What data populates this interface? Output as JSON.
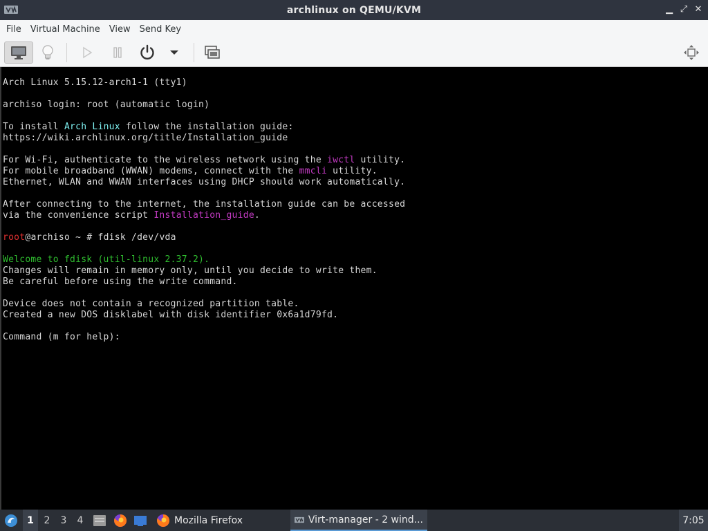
{
  "window": {
    "title": "archlinux on QEMU/KVM",
    "icon": "virt-manager-icon",
    "controls": [
      {
        "name": "minimize-button",
        "glyph": "▁"
      },
      {
        "name": "maximize-button",
        "glyph": "⤢"
      },
      {
        "name": "close-button",
        "glyph": "✕"
      }
    ]
  },
  "menu": {
    "file": "File",
    "vm": "Virtual Machine",
    "view": "View",
    "send_key": "Send Key"
  },
  "toolbar": {
    "icons": [
      "console-icon",
      "details-lightbulb-icon",
      "run-icon",
      "pause-icon",
      "power-icon",
      "power-menu-icon",
      "snapshots-icon",
      "fullscreen-icon"
    ]
  },
  "terminal": {
    "lines": [
      {
        "segments": [
          {
            "text": "Arch Linux 5.15.12-arch1-1 (tty1)",
            "color": ""
          }
        ]
      },
      {
        "segments": [
          {
            "text": "archiso login: root (automatic login)",
            "color": ""
          }
        ]
      },
      {
        "segments": [
          {
            "text": "To install ",
            "color": ""
          },
          {
            "text": "Arch Linux",
            "color": "cyan"
          },
          {
            "text": " follow the installation guide:",
            "color": ""
          }
        ]
      },
      {
        "segments": [
          {
            "text": "https://wiki.archlinux.org/title/Installation_guide",
            "color": ""
          }
        ]
      },
      {
        "segments": [
          {
            "text": "For Wi-Fi, authenticate to the wireless network using the ",
            "color": ""
          },
          {
            "text": "iwctl",
            "color": "magenta"
          },
          {
            "text": " utility.",
            "color": ""
          }
        ]
      },
      {
        "segments": [
          {
            "text": "For mobile broadband (WWAN) modems, connect with the ",
            "color": ""
          },
          {
            "text": "mmcli",
            "color": "magenta"
          },
          {
            "text": " utility.",
            "color": ""
          }
        ]
      },
      {
        "segments": [
          {
            "text": "Ethernet, WLAN and WWAN interfaces using DHCP should work automatically.",
            "color": ""
          }
        ]
      },
      {
        "segments": [
          {
            "text": "After connecting to the internet, the installation guide can be accessed",
            "color": ""
          }
        ]
      },
      {
        "segments": [
          {
            "text": "via the convenience script ",
            "color": ""
          },
          {
            "text": "Installation_guide",
            "color": "magenta"
          },
          {
            "text": ".",
            "color": ""
          }
        ]
      },
      {
        "segments": [
          {
            "text": "root",
            "color": "red"
          },
          {
            "text": "@archiso ~ # fdisk /dev/vda",
            "color": ""
          }
        ]
      },
      {
        "segments": [
          {
            "text": "Welcome to fdisk (util-linux 2.37.2).",
            "color": "green"
          }
        ]
      },
      {
        "segments": [
          {
            "text": "Changes will remain in memory only, until you decide to write them.",
            "color": ""
          }
        ]
      },
      {
        "segments": [
          {
            "text": "Be careful before using the write command.",
            "color": ""
          }
        ]
      },
      {
        "segments": [
          {
            "text": "Device does not contain a recognized partition table.",
            "color": ""
          }
        ]
      },
      {
        "segments": [
          {
            "text": "Created a new DOS disklabel with disk identifier 0x6a1d79fd.",
            "color": ""
          }
        ]
      },
      {
        "segments": [
          {
            "text": "Command (m for help): ",
            "color": ""
          }
        ]
      }
    ]
  },
  "taskbar": {
    "start_icon": "lxqt-menu-icon",
    "workspaces": [
      "1",
      "2",
      "3",
      "4"
    ],
    "current_workspace": "1",
    "quicklaunch": [
      "file-manager-icon",
      "firefox-icon",
      "desktop-icon"
    ],
    "tasks": [
      {
        "label": "Mozilla Firefox",
        "icon": "firefox-icon",
        "active": false
      },
      {
        "label": "Virt-manager - 2 wind...",
        "icon": "virt-manager-icon",
        "active": true
      }
    ],
    "clock": "7:05"
  },
  "colors": {
    "titlebar": "#2f343f",
    "toolbar": "#f5f6f7",
    "terminal_bg": "#000000",
    "taskbar": "#2b2f36"
  }
}
